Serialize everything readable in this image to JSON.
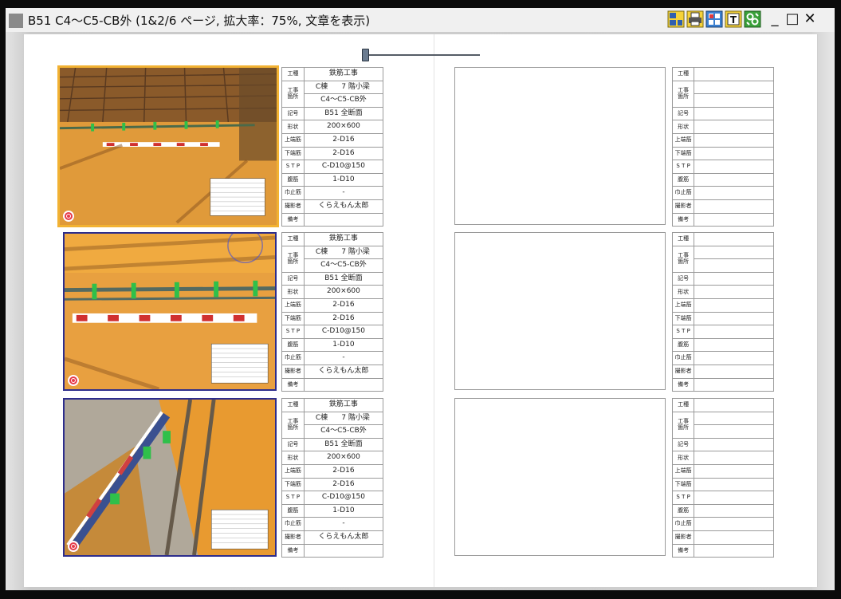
{
  "window": {
    "title": "B51 C4～C5-CB外 (1&2/6 ページ, 拡大率：75%, 文章を表示)"
  },
  "toolbar": {
    "icons": [
      "layout-icon",
      "print-icon",
      "grid-view-icon",
      "text-icon",
      "settings-icon"
    ],
    "window_buttons": {
      "minimize": "_",
      "maximize": "□",
      "close": "✕"
    }
  },
  "colors": {
    "selected_border": "#f2b233",
    "photo_border": "#2d2d8c"
  },
  "labels": {
    "kouju": "工種",
    "kouji": "工事",
    "kasho": "箇所",
    "kigou": "記号",
    "keijou": "形状",
    "uwabakin": "上端筋",
    "shitabakin": "下端筋",
    "stp": "S T P",
    "harakin": "腹筋",
    "habadome": "巾止筋",
    "satsueisha": "撮影者",
    "bikou": "備考"
  },
  "records": [
    {
      "kouju": "鉄筋工事",
      "kasho_1a": "C棟",
      "kasho_1b": "7 階小梁",
      "kasho_2": "C4～C5-CB外",
      "kigou": "B51 全断面",
      "keijou": "200×600",
      "uwabakin": "2-D16",
      "shitabakin": "2-D16",
      "stp": "C-D10@150",
      "harakin": "1-D10",
      "habadome": "-",
      "satsueisha": "くらえもん太郎",
      "bikou": ""
    },
    {
      "kouju": "鉄筋工事",
      "kasho_1a": "C棟",
      "kasho_1b": "7 階小梁",
      "kasho_2": "C4～C5-CB外",
      "kigou": "B51 全断面",
      "keijou": "200×600",
      "uwabakin": "2-D16",
      "shitabakin": "2-D16",
      "stp": "C-D10@150",
      "harakin": "1-D10",
      "habadome": "-",
      "satsueisha": "くらえもん太郎",
      "bikou": ""
    },
    {
      "kouju": "鉄筋工事",
      "kasho_1a": "C棟",
      "kasho_1b": "7 階小梁",
      "kasho_2": "C4～C5-CB外",
      "kigou": "B51 全断面",
      "keijou": "200×600",
      "uwabakin": "2-D16",
      "shitabakin": "2-D16",
      "stp": "C-D10@150",
      "harakin": "1-D10",
      "habadome": "-",
      "satsueisha": "くらえもん太郎",
      "bikou": ""
    }
  ]
}
